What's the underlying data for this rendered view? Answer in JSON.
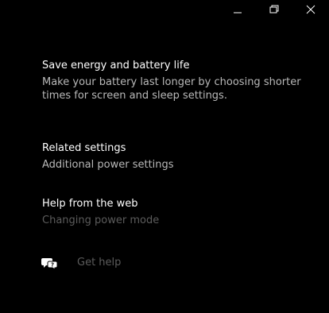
{
  "window": {
    "controls": {
      "minimize": "minimize-icon",
      "restore": "restore-icon",
      "close": "close-icon"
    }
  },
  "save_energy": {
    "title": "Save energy and battery life",
    "description": "Make your battery last longer by choosing shorter times for screen and sleep settings."
  },
  "related_settings": {
    "title": "Related settings",
    "links": [
      "Additional power settings"
    ]
  },
  "help_web": {
    "title": "Help from the web",
    "links": [
      "Changing power mode"
    ]
  },
  "get_help": {
    "label": "Get help",
    "icon": "chat-help-icon"
  },
  "colors": {
    "background": "#000000",
    "heading": "#ffffff",
    "text": "#b9b9b9",
    "disabled": "#5c5c5c"
  }
}
